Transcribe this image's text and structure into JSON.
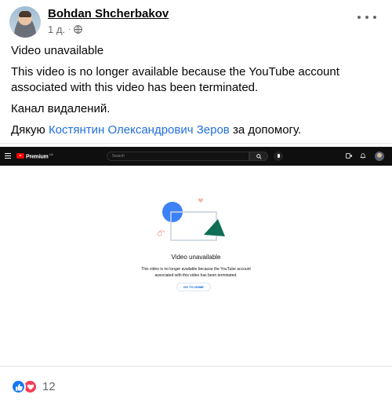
{
  "post": {
    "author": "Bohdan Shcherbakov",
    "time": "1 д.",
    "separator": "·",
    "privacy_icon": "globe-icon",
    "more_icon": "more-options-icon",
    "paragraphs": {
      "p1": "Video unavailable",
      "p2": "This video is no longer available because the YouTube account associated with this video has been terminated.",
      "p3": "Канал видалений.",
      "p4_before": "Дякую ",
      "p4_mention": "Костянтин Олександрович Зеров",
      "p4_after": " за допомогу."
    }
  },
  "embed": {
    "youtube_bar": {
      "brand": "Premium",
      "region": "UA",
      "search_placeholder": "Search",
      "colors": {
        "bar": "#0f0f0f",
        "logo": "#ff0000"
      }
    },
    "error": {
      "title": "Video unavailable",
      "description": "This video is no longer available because the YouTube account associated with this video has been terminated.",
      "button": "GO TO HOME"
    }
  },
  "reactions": {
    "types": [
      "like",
      "love"
    ],
    "count": "12",
    "colors": {
      "like": "#1877f2",
      "love": "#f33e58"
    }
  }
}
